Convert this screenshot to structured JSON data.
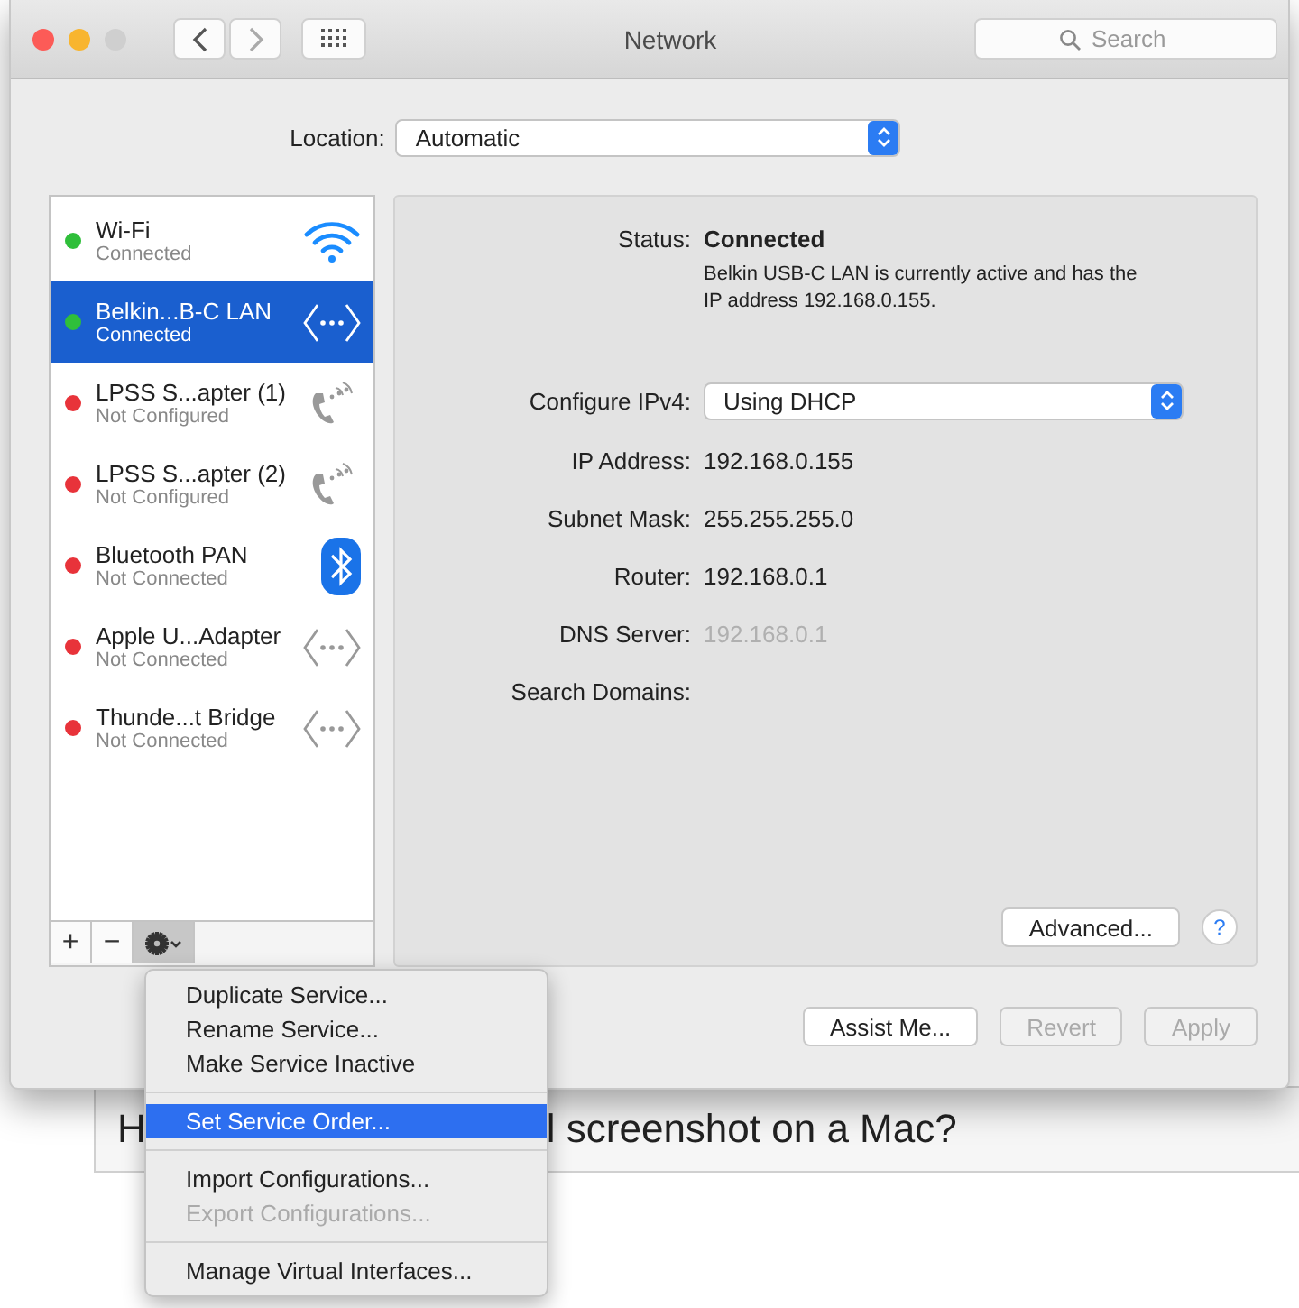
{
  "window": {
    "title": "Network",
    "search": {
      "placeholder": "Search"
    }
  },
  "location": {
    "label": "Location:",
    "value": "Automatic"
  },
  "services": [
    {
      "name": "Wi-Fi",
      "status": "Connected",
      "color": "#2fbf3a",
      "kind": "wifi",
      "selected": false
    },
    {
      "name": "Belkin...B-C LAN",
      "status": "Connected",
      "color": "#2fbf3a",
      "kind": "ethernet",
      "selected": true
    },
    {
      "name": "LPSS S...apter (1)",
      "status": "Not Configured",
      "color": "#e8333a",
      "kind": "phone",
      "selected": false
    },
    {
      "name": "LPSS S...apter (2)",
      "status": "Not Configured",
      "color": "#e8333a",
      "kind": "phone",
      "selected": false
    },
    {
      "name": "Bluetooth PAN",
      "status": "Not Connected",
      "color": "#e8333a",
      "kind": "bluetooth",
      "selected": false
    },
    {
      "name": "Apple U...Adapter",
      "status": "Not Connected",
      "color": "#e8333a",
      "kind": "ethernet",
      "selected": false
    },
    {
      "name": "Thunde...t Bridge",
      "status": "Not Connected",
      "color": "#e8333a",
      "kind": "ethernet",
      "selected": false
    }
  ],
  "details": [
    {
      "kind": "status",
      "label": "Status:",
      "value": "Connected",
      "description": "Belkin USB-C LAN is currently active and has the IP address 192.168.0.155."
    },
    {
      "kind": "select",
      "label": "Configure IPv4:",
      "value": "Using DHCP"
    },
    {
      "kind": "text",
      "label": "IP Address:",
      "value": "192.168.0.155",
      "disabled": false
    },
    {
      "kind": "text",
      "label": "Subnet Mask:",
      "value": "255.255.255.0",
      "disabled": false
    },
    {
      "kind": "text",
      "label": "Router:",
      "value": "192.168.0.1",
      "disabled": false
    },
    {
      "kind": "text",
      "label": "DNS Server:",
      "value": "192.168.0.1",
      "disabled": true
    },
    {
      "kind": "text",
      "label": "Search Domains:"
    }
  ],
  "advanced_button": "Advanced...",
  "help_button": "?",
  "list_controls": [
    "+",
    "−"
  ],
  "buttons": [
    {
      "label": "Assist Me...",
      "disabled": false
    },
    {
      "label": "Revert",
      "disabled": true
    },
    {
      "label": "Apply",
      "disabled": true
    }
  ],
  "menu": [
    [
      {
        "label": "Duplicate Service...",
        "disabled": false,
        "selected": false
      },
      {
        "label": "Rename Service...",
        "disabled": false,
        "selected": false
      },
      {
        "label": "Make Service Inactive",
        "disabled": false,
        "selected": false
      }
    ],
    [
      {
        "label": "Set Service Order...",
        "disabled": false,
        "selected": true
      }
    ],
    [
      {
        "label": "Import Configurations...",
        "disabled": false,
        "selected": false
      },
      {
        "label": "Export Configurations...",
        "disabled": true,
        "selected": false
      }
    ],
    [
      {
        "label": "Manage Virtual Interfaces...",
        "disabled": false,
        "selected": false
      }
    ]
  ],
  "background_page": {
    "headline_parts": [
      "H",
      "l screenshot on a Mac?"
    ]
  }
}
